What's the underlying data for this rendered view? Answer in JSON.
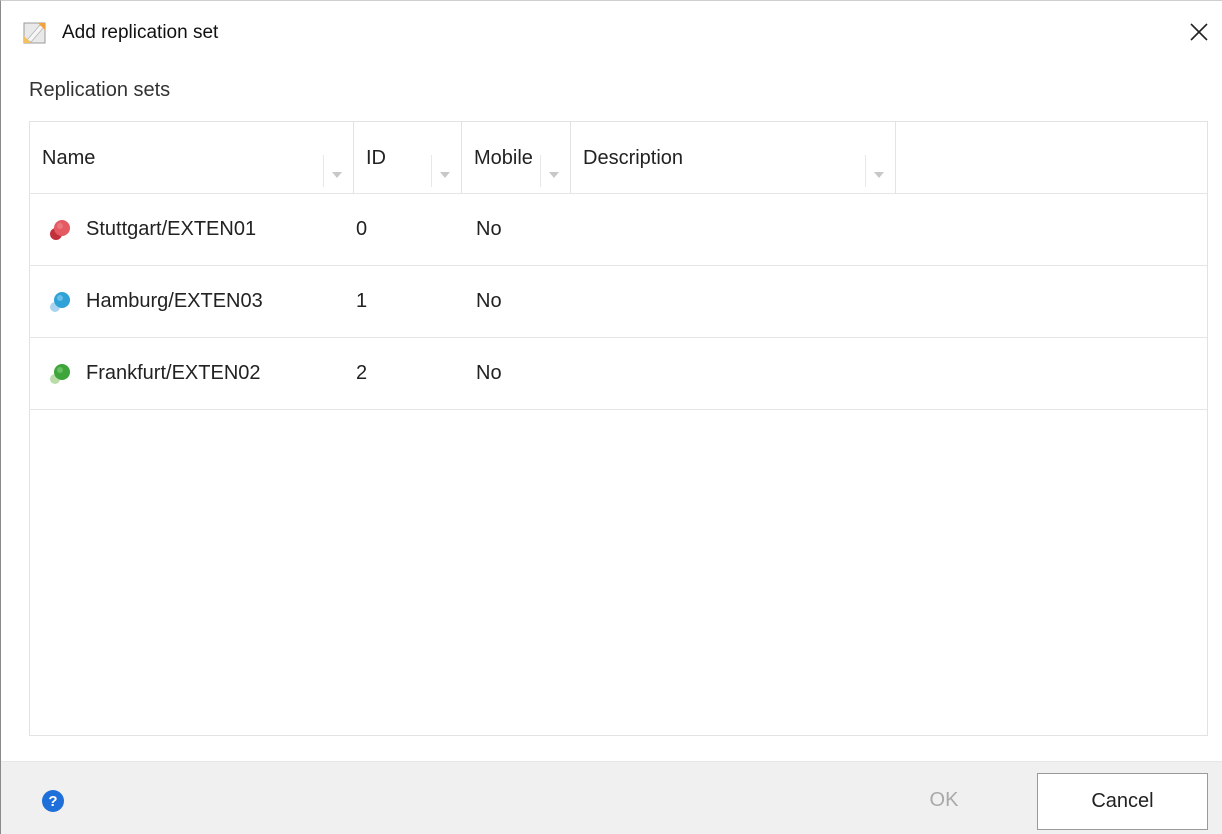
{
  "window": {
    "title": "Add replication set",
    "app_icon": "document-edit-icon",
    "close_icon": "close-icon"
  },
  "section_label": "Replication sets",
  "table": {
    "columns": [
      {
        "label": "Name"
      },
      {
        "label": "ID"
      },
      {
        "label": "Mobile"
      },
      {
        "label": "Description"
      }
    ],
    "rows": [
      {
        "name": "Stuttgart/EXTEN01",
        "id": "0",
        "mobile": "No",
        "description": "",
        "icon": "red-replication-icon",
        "color": "#d9454f"
      },
      {
        "name": "Hamburg/EXTEN03",
        "id": "1",
        "mobile": "No",
        "description": "",
        "icon": "blue-replication-icon",
        "color": "#2fa3d8"
      },
      {
        "name": "Frankfurt/EXTEN02",
        "id": "2",
        "mobile": "No",
        "description": "",
        "icon": "green-replication-icon",
        "color": "#3ea53a"
      }
    ]
  },
  "footer": {
    "help_icon": "help-icon",
    "ok_label": "OK",
    "cancel_label": "Cancel"
  },
  "colors": {
    "accent": "#1e6fd9",
    "footer_bg": "#f0f0f0"
  }
}
